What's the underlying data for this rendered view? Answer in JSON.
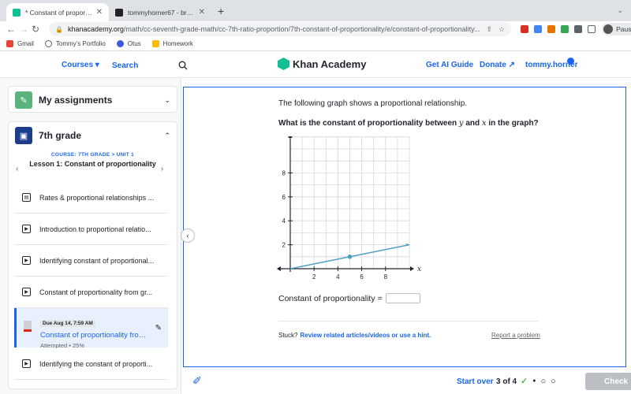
{
  "browser": {
    "tabs": [
      {
        "title": "* Constant of proportionality fr",
        "active": true
      },
      {
        "title": "tommyhorner67 - brainly.com",
        "active": false
      }
    ],
    "new_tab": "+",
    "url_host": "khanacademy.org",
    "url_path": "/math/cc-seventh-grade-math/cc-7th-ratio-proportion/7th-constant-of-proportionality/e/constant-of-proportionality...",
    "profile_status": "Paused",
    "bookmarks": [
      "Gmail",
      "Tommy's Portfolio",
      "Otus",
      "Homework"
    ]
  },
  "header": {
    "courses": "Courses ▾",
    "search": "Search",
    "logo": "Khan Academy",
    "ai_guide": "Get AI Guide",
    "donate": "Donate ↗",
    "user": "tommy.horner"
  },
  "sidebar": {
    "assignments": "My assignments",
    "grade": "7th grade",
    "unit_label": "COURSE: 7TH GRADE > UNIT 1",
    "lesson": "Lesson 1: Constant of proportionality",
    "items": [
      {
        "label": "Rates & proportional relationships ...",
        "icon": "article-icon"
      },
      {
        "label": "Introduction to proportional relatio...",
        "icon": "video-icon"
      },
      {
        "label": "Identifying constant of proportional...",
        "icon": "video-icon"
      },
      {
        "label": "Constant of proportionality from gr...",
        "icon": "video-icon"
      },
      {
        "label": "Identifying the constant of proporti...",
        "icon": "video-icon"
      }
    ],
    "active": {
      "due": "Due Aug 14, 7:59 AM",
      "title": "Constant of proportionality from ...",
      "status": "Attempted • 25%"
    }
  },
  "question": {
    "intro": "The following graph shows a proportional relationship.",
    "prompt_pre": "What is the constant of proportionality between ",
    "var_y": "y",
    "and": " and ",
    "var_x": "x",
    "prompt_post": " in the graph?",
    "answer_label": "Constant of proportionality",
    "equals": "=",
    "stuck": "Stuck?",
    "hint_link": "Review related articles/videos or use a hint.",
    "report": "Report a problem"
  },
  "chart_data": {
    "type": "line",
    "xlabel": "x",
    "ylabel": "y",
    "xlim": [
      0,
      10
    ],
    "ylim": [
      0,
      11
    ],
    "x_ticks": [
      2,
      4,
      6,
      8
    ],
    "y_ticks": [
      2,
      4,
      6,
      8
    ],
    "grid": true,
    "series": [
      {
        "x": [
          0,
          10
        ],
        "values": [
          0,
          2
        ],
        "color": "#4a9fc4"
      }
    ],
    "points": [
      {
        "x": 5,
        "y": 1
      }
    ]
  },
  "footer": {
    "start_over": "Start over",
    "progress": "3 of 4",
    "check": "Check",
    "dots": [
      "✓",
      "●",
      "○",
      "○"
    ]
  },
  "colors": {
    "accent": "#1865f2",
    "kh_green": "#14bf96",
    "line": "#4a9fc4"
  }
}
